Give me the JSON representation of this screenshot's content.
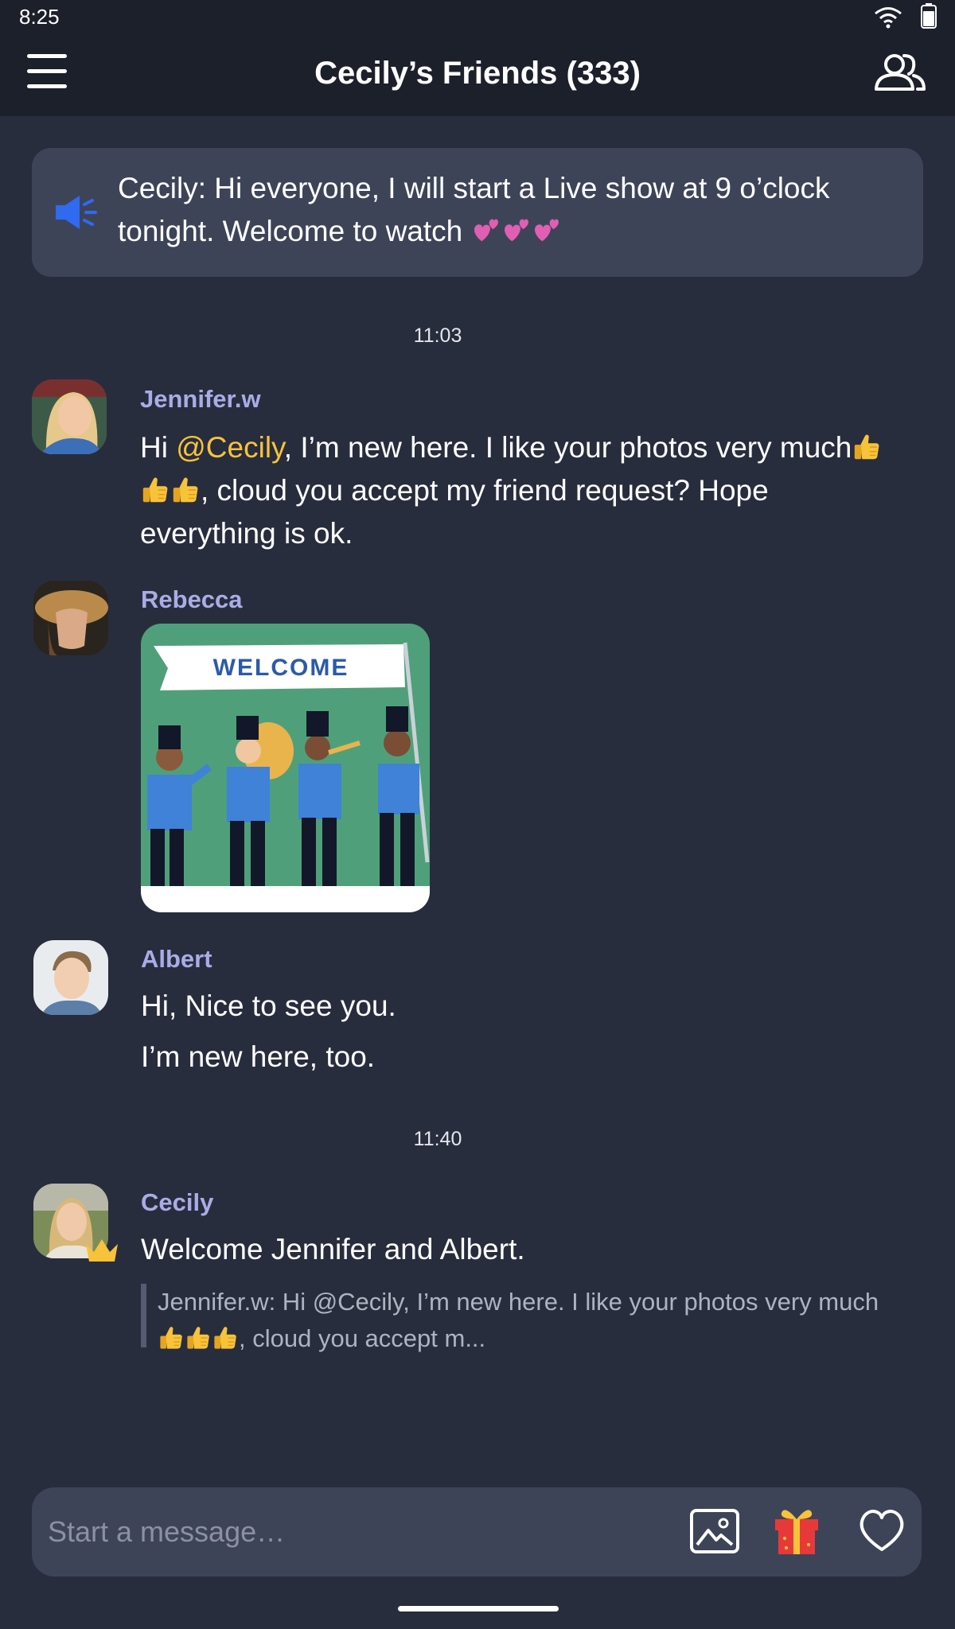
{
  "status_bar": {
    "time": "8:25"
  },
  "header": {
    "title": "Cecily’s Friends (333)"
  },
  "announcement": {
    "text_prefix": "Cecily: Hi everyone, I will start a Live show at 9 o’clock tonight. Welcome to watch",
    "emoji": "two-hearts-emoji"
  },
  "timestamps": [
    "11:03",
    "11:40"
  ],
  "messages": [
    {
      "sender": "Jennifer.w",
      "greeting": "Hi ",
      "mention": "@Cecily",
      "text_part1": ", I’m new here. I like your photos very much",
      "text_part2": ", cloud you accept my friend request? Hope everything is ok."
    },
    {
      "sender": "Rebecca",
      "sticker_text": "WELCOME"
    },
    {
      "sender": "Albert",
      "line1": "Hi, Nice to see you.",
      "line2": "I’m new here,  too."
    },
    {
      "sender": "Cecily",
      "text": "Welcome Jennifer and Albert.",
      "quote_part1": "Jennifer.w: Hi @Cecily, I’m new here. I like your photos very much",
      "quote_part2": ", cloud you accept m..."
    }
  ],
  "composer": {
    "placeholder": "Start a message…"
  },
  "icons": {
    "menu": "hamburger-icon",
    "friends": "group-icon",
    "announcement": "megaphone-icon",
    "image": "image-icon",
    "gift": "gift-icon",
    "like": "heart-icon",
    "admin": "crown-icon",
    "thumbs": "thumbs-up-emoji"
  },
  "colors": {
    "background": "#282d3d",
    "header": "#1c202b",
    "card": "#3e4458",
    "sender": "#a9ade6",
    "mention": "#f7c33b",
    "megaphone": "#2f6af0"
  }
}
